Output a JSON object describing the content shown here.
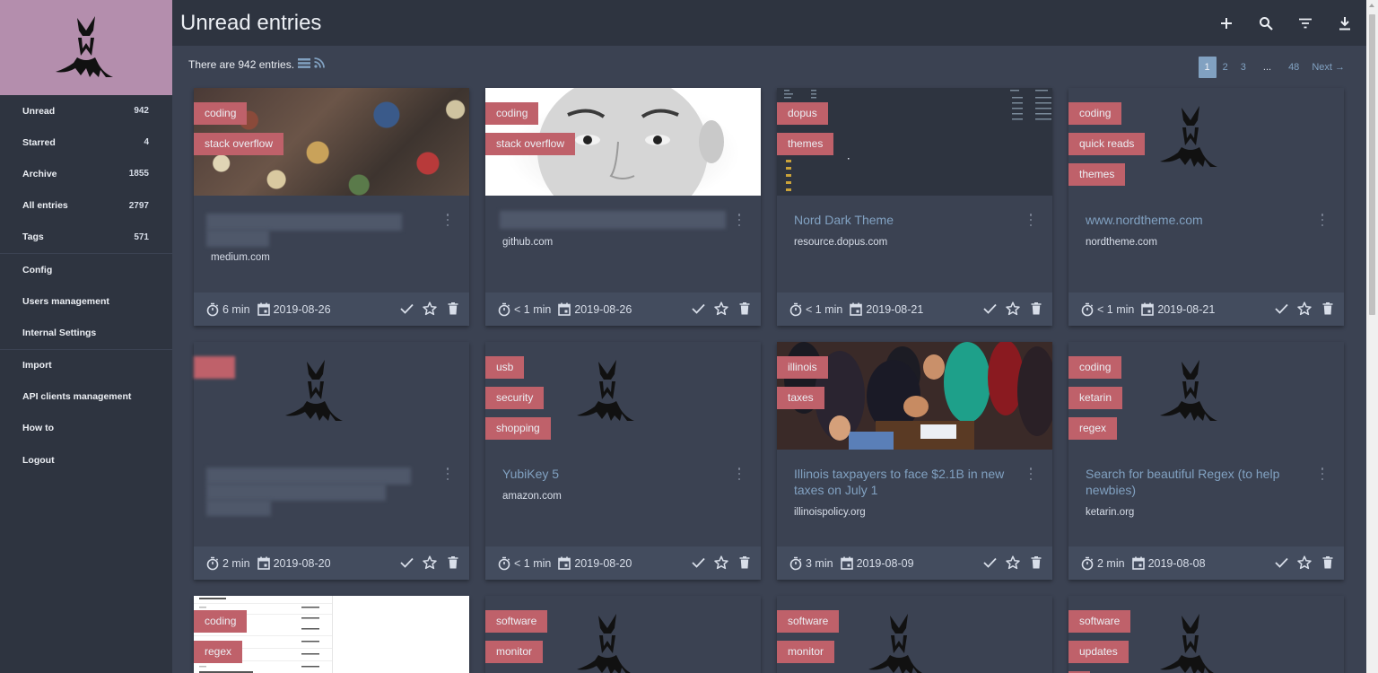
{
  "sidebar": {
    "items": [
      {
        "label": "Unread",
        "count": "942"
      },
      {
        "label": "Starred",
        "count": "4"
      },
      {
        "label": "Archive",
        "count": "1855"
      },
      {
        "label": "All entries",
        "count": "2797"
      },
      {
        "label": "Tags",
        "count": "571"
      },
      {
        "label": "Config",
        "count": ""
      },
      {
        "label": "Users management",
        "count": ""
      },
      {
        "label": "Internal Settings",
        "count": ""
      },
      {
        "label": "Import",
        "count": ""
      },
      {
        "label": "API clients management",
        "count": ""
      },
      {
        "label": "How to",
        "count": ""
      },
      {
        "label": "Logout",
        "count": ""
      }
    ]
  },
  "header": {
    "title": "Unread entries"
  },
  "info": {
    "text": "There are 942 entries."
  },
  "pagination": {
    "pages": [
      "1",
      "2",
      "3"
    ],
    "ellipsis": "...",
    "last": "48",
    "next": "Next →"
  },
  "colors": {
    "sidebar": "#2e3440",
    "logo_bg": "#b48ead",
    "tag": "#bf616a",
    "link": "#81a1c1"
  },
  "cards": [
    {
      "tags": [
        "coding",
        "stack overflow"
      ],
      "title": "",
      "domain": "medium.com",
      "time": "6 min",
      "date": "2019-08-26"
    },
    {
      "tags": [
        "coding",
        "stack overflow"
      ],
      "title": "",
      "domain": "github.com",
      "time": "< 1 min",
      "date": "2019-08-26"
    },
    {
      "tags": [
        "dopus",
        "themes"
      ],
      "title": "Nord Dark Theme",
      "domain": "resource.dopus.com",
      "time": "< 1 min",
      "date": "2019-08-21"
    },
    {
      "tags": [
        "coding",
        "quick reads",
        "themes"
      ],
      "title": "www.nordtheme.com",
      "domain": "nordtheme.com",
      "time": "< 1 min",
      "date": "2019-08-21"
    },
    {
      "tags": [
        ""
      ],
      "title": "",
      "domain": "",
      "time": "2 min",
      "date": "2019-08-20"
    },
    {
      "tags": [
        "usb",
        "security",
        "shopping"
      ],
      "title": "YubiKey 5",
      "domain": "amazon.com",
      "time": "< 1 min",
      "date": "2019-08-20"
    },
    {
      "tags": [
        "illinois",
        "taxes"
      ],
      "title": "Illinois taxpayers to face $2.1B in new taxes on July 1",
      "domain": "illinoispolicy.org",
      "time": "3 min",
      "date": "2019-08-09"
    },
    {
      "tags": [
        "coding",
        "ketarin",
        "regex"
      ],
      "title": "Search for beautiful Regex (to help newbies)",
      "domain": "ketarin.org",
      "time": "2 min",
      "date": "2019-08-08"
    },
    {
      "tags": [
        "coding",
        "regex"
      ]
    },
    {
      "tags": [
        "software",
        "monitor"
      ]
    },
    {
      "tags": [
        "software",
        "monitor"
      ]
    },
    {
      "tags": [
        "software",
        "updates"
      ]
    }
  ],
  "icons": {
    "top": [
      "add-icon",
      "search-icon",
      "filter-icon",
      "download-icon"
    ],
    "footer": [
      "timer-icon",
      "calendar-icon",
      "check-icon",
      "star-icon",
      "delete-icon"
    ]
  }
}
